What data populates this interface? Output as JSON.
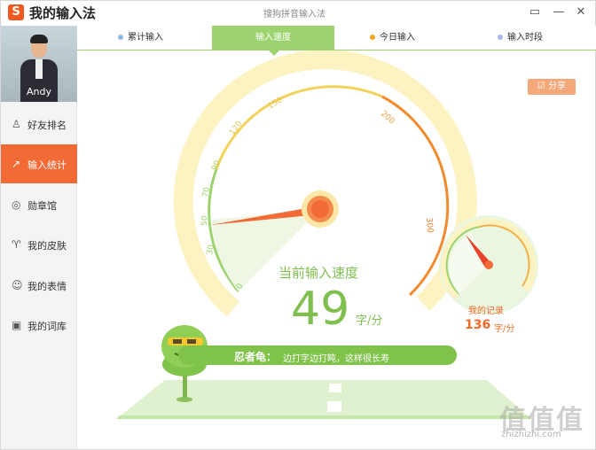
{
  "titlebar": {
    "app_title": "我的输入法",
    "window_title": "搜狗拼音输入法",
    "logo_letter": "S"
  },
  "user": {
    "name": "Andy"
  },
  "sidebar": {
    "items": [
      {
        "label": "好友排名",
        "icon": "friends-icon"
      },
      {
        "label": "输入统计",
        "icon": "chart-icon",
        "active": true
      },
      {
        "label": "勋章馆",
        "icon": "medal-icon"
      },
      {
        "label": "我的皮肤",
        "icon": "shirt-icon"
      },
      {
        "label": "我的表情",
        "icon": "smile-icon"
      },
      {
        "label": "我的词库",
        "icon": "book-icon"
      }
    ]
  },
  "tabs": [
    {
      "label": "累计输入",
      "dot_color": "#8cb8e8"
    },
    {
      "label": "输入速度",
      "active": true
    },
    {
      "label": "今日输入",
      "dot_color": "#f5a623"
    },
    {
      "label": "输入时段",
      "dot_color": "#a8b8e8"
    }
  ],
  "share": {
    "label": "分享"
  },
  "gauge": {
    "ticks": [
      "0",
      "30",
      "50",
      "70",
      "90",
      "120",
      "150",
      "200",
      "300"
    ],
    "current_speed_label": "当前输入速度",
    "current_speed_value": "49",
    "unit": "字/分",
    "current_value": 49
  },
  "record": {
    "label": "我的记录",
    "value": "136",
    "unit": "字/分",
    "numeric_value": 136
  },
  "banner": {
    "name": "忍者龟：",
    "text": "边打字边打盹，这样很长寿"
  },
  "colors": {
    "accent_orange": "#f26a36",
    "accent_green": "#9dd36f",
    "text_green": "#7fbf4f",
    "record_orange": "#f06a2a"
  },
  "watermark": {
    "text": "值值值",
    "url": "zhizhizhi.com"
  }
}
